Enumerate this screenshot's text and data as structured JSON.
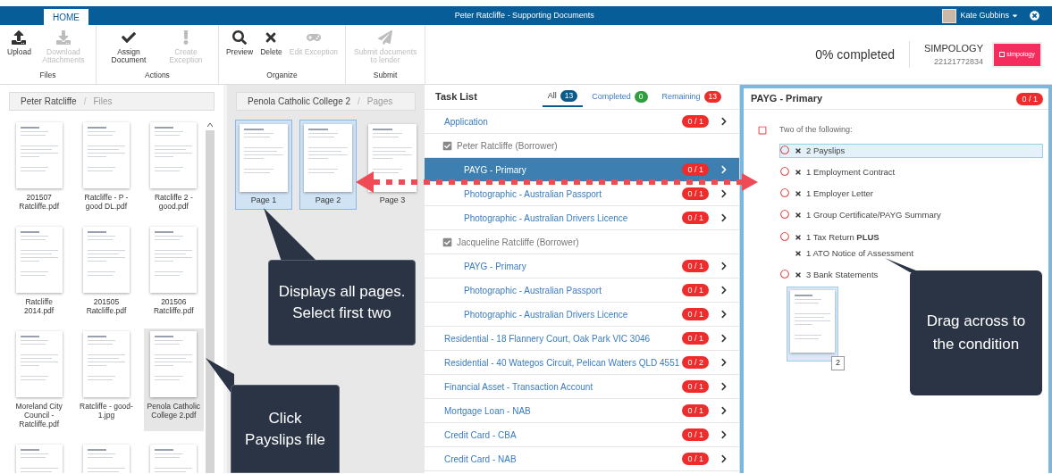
{
  "top_bar": {
    "tabs": [
      {
        "label": "HOME",
        "selected": true
      }
    ],
    "title": "Peter Ratcliffe - Supporting Documents",
    "user": "Kate Gubbins"
  },
  "ribbon": {
    "groups": [
      {
        "label": "Files",
        "buttons": [
          {
            "kind": "upload",
            "label": "Upload",
            "disabled": false
          },
          {
            "kind": "download",
            "label": "Download Attachments",
            "disabled": true
          }
        ]
      },
      {
        "label": "Actions",
        "buttons": [
          {
            "kind": "check",
            "label": "Assign Document",
            "disabled": false
          },
          {
            "kind": "exclamation",
            "label": "Create Exception",
            "disabled": true
          }
        ]
      },
      {
        "label": "Organize",
        "buttons": [
          {
            "kind": "search",
            "label": "Preview",
            "disabled": false
          },
          {
            "kind": "delete",
            "label": "Delete",
            "disabled": false
          },
          {
            "kind": "gamepad",
            "label": "Edit Exception",
            "disabled": true
          }
        ]
      },
      {
        "label": "Submit",
        "buttons": [
          {
            "kind": "send",
            "label": "Submit documents to lender",
            "disabled": true
          }
        ]
      }
    ],
    "progress": "0% completed",
    "company": "SIMPOLOGY",
    "company_id": "22121772834",
    "logo_text": "simpology"
  },
  "files_panel": {
    "breadcrumb": [
      "Peter Ratcliffe",
      "Files"
    ],
    "separator": "/",
    "files": [
      {
        "name": "201507 Ratcliffe.pdf",
        "selected": false
      },
      {
        "name": "Ratcliffe - P - good DL.pdf",
        "selected": false
      },
      {
        "name": "Ratcliffe 2 - good.pdf",
        "selected": false
      },
      {
        "name": "Ratcliffe 2014.pdf",
        "selected": false
      },
      {
        "name": "201505 Ratcliffe.pdf",
        "selected": false
      },
      {
        "name": "201506 Ratcliffe.pdf",
        "selected": false
      },
      {
        "name": "Moreland City Council - Ratcliffe.pdf",
        "selected": false
      },
      {
        "name": "Ratcliffe - good-1.jpg",
        "selected": false
      },
      {
        "name": "Penola Catholic College 2.pdf",
        "selected": true
      }
    ]
  },
  "pages_panel": {
    "breadcrumb": [
      "Penola Catholic College 2",
      "Pages"
    ],
    "separator": "/",
    "pages": [
      {
        "label": "Page 1",
        "selected": true
      },
      {
        "label": "Page 2",
        "selected": true
      },
      {
        "label": "Page 3",
        "selected": false
      }
    ]
  },
  "task_list": {
    "title": "Task List",
    "tabs": [
      {
        "label": "All",
        "count": "13",
        "color": "#0b5a8c",
        "selected": true
      },
      {
        "label": "Completed",
        "count": "0",
        "color": "#2e9e3e",
        "selected": false
      },
      {
        "label": "Remaining",
        "count": "13",
        "color": "#ee2c2c",
        "selected": false
      }
    ],
    "rows": [
      {
        "kind": "task",
        "label": "Application",
        "count": "0 / 1",
        "selected": false
      },
      {
        "kind": "group",
        "label": "Peter Ratcliffe (Borrower)",
        "checked": true,
        "children": [
          {
            "kind": "task",
            "label": "PAYG - Primary",
            "count": "0 / 1",
            "selected": true
          },
          {
            "kind": "task",
            "label": "Photographic - Australian Passport",
            "count": "0 / 1",
            "selected": false
          },
          {
            "kind": "task",
            "label": "Photographic - Australian Drivers Licence",
            "count": "0 / 1",
            "selected": false
          }
        ]
      },
      {
        "kind": "group",
        "label": "Jacqueline Ratcliffe (Borrower)",
        "checked": true,
        "children": [
          {
            "kind": "task",
            "label": "PAYG - Primary",
            "count": "0 / 1",
            "selected": false
          },
          {
            "kind": "task",
            "label": "Photographic - Australian Passport",
            "count": "0 / 1",
            "selected": false
          },
          {
            "kind": "task",
            "label": "Photographic - Australian Drivers Licence",
            "count": "0 / 1",
            "selected": false
          }
        ]
      },
      {
        "kind": "task",
        "label": "Residential - 18 Flannery Court, Oak Park VIC 3046",
        "count": "0 / 1",
        "selected": false
      },
      {
        "kind": "task",
        "label": "Residential - 40 Wategos Circuit, Pelican Waters QLD 4551",
        "count": "0 / 2",
        "selected": false
      },
      {
        "kind": "task",
        "label": "Financial Asset - Transaction Account",
        "count": "0 / 1",
        "selected": false
      },
      {
        "kind": "task",
        "label": "Mortgage Loan - NAB",
        "count": "0 / 1",
        "selected": false
      },
      {
        "kind": "task",
        "label": "Credit Card - CBA",
        "count": "0 / 1",
        "selected": false
      },
      {
        "kind": "task",
        "label": "Credit Card - NAB",
        "count": "0 / 1",
        "selected": false
      }
    ]
  },
  "condition_panel": {
    "title": "PAYG - Primary",
    "count": "0 / 1",
    "condition": {
      "label": "Two of the following:",
      "checked": false
    },
    "options": [
      {
        "items": [
          "2 Payslips"
        ],
        "highlighted": true
      },
      {
        "items": [
          "1 Employment Contract"
        ],
        "highlighted": false
      },
      {
        "items": [
          "1 Employer Letter"
        ],
        "highlighted": false
      },
      {
        "items": [
          "1 Group Certificate/PAYG Summary"
        ],
        "highlighted": false
      },
      {
        "items": [
          "1 Tax Return **PLUS**",
          "1 ATO Notice of Assessment"
        ],
        "highlighted": false
      },
      {
        "items": [
          "3 Bank Statements"
        ],
        "highlighted": false
      }
    ],
    "drag_preview": {
      "count": "2"
    }
  },
  "callouts": [
    {
      "kind": "pages",
      "text": "Displays all pages. Select first two"
    },
    {
      "kind": "file",
      "text": "Click Payslips file"
    },
    {
      "kind": "drag",
      "text": "Drag across to the condition"
    }
  ]
}
